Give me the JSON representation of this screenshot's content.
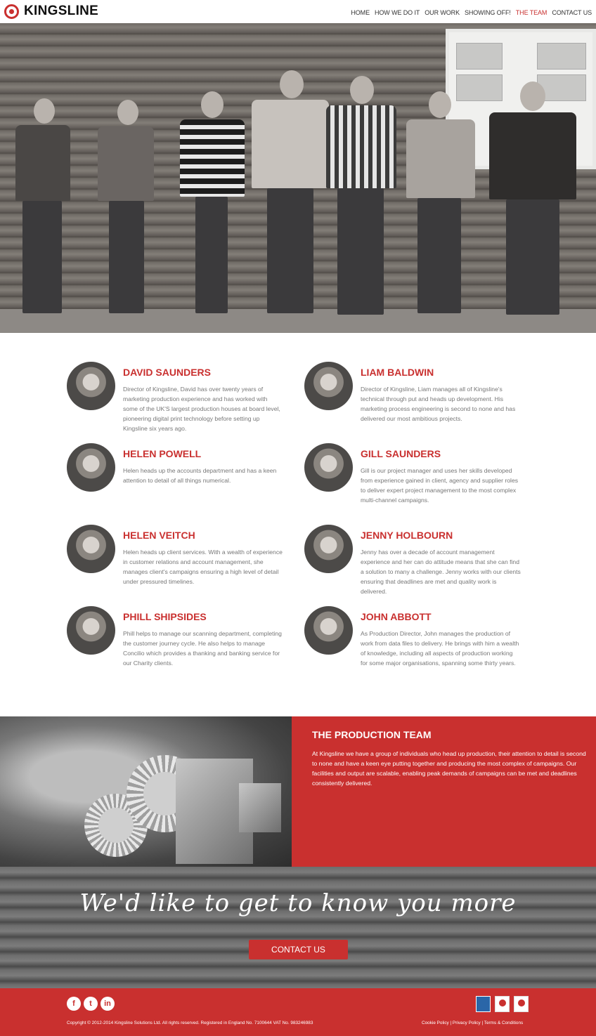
{
  "brand": {
    "name": "KINGSLINE",
    "accent": "#c9302f"
  },
  "nav": {
    "items": [
      {
        "label": "HOME"
      },
      {
        "label": "HOW WE DO IT"
      },
      {
        "label": "OUR WORK"
      },
      {
        "label": "SHOWING OFF!"
      },
      {
        "label": "THE TEAM"
      },
      {
        "label": "CONTACT US"
      }
    ],
    "active": "THE TEAM"
  },
  "team": [
    {
      "name": "DAVID SAUNDERS",
      "bio": "Director of Kingsline, David has over twenty years of marketing production experience and has worked with some of the UK'S largest production houses at board level, pioneering digital print technology before setting up Kingsline six years ago."
    },
    {
      "name": "LIAM BALDWIN",
      "bio": "Director of Kingsline, Liam manages all of Kingsline's technical through put and heads up development. His marketing process engineering is second to none and has delivered our most ambitious projects."
    },
    {
      "name": "HELEN POWELL",
      "bio": "Helen heads up the accounts department and has a keen attention to detail of all things numerical."
    },
    {
      "name": "GILL SAUNDERS",
      "bio": "Gill is our project manager and uses her skills developed from experience gained in client, agency and supplier roles to deliver expert project management to the most complex multi-channel campaigns."
    },
    {
      "name": "HELEN VEITCH",
      "bio": "Helen heads up client services. With a wealth of experience in customer relations and account management, she manages client's campaigns ensuring a high level of detail under pressured timelines."
    },
    {
      "name": "JENNY HOLBOURN",
      "bio": "Jenny has over a decade of account management experience and her can do attitude means that she can find a solution to many a challenge. Jenny works with our clients ensuring that deadlines are met and quality work is delivered."
    },
    {
      "name": "PHILL SHIPSIDES",
      "bio": "Phill helps to manage our scanning department, completing the customer journey cycle. He also helps to manage Concilio which provides a thanking and banking service for our Charity clients."
    },
    {
      "name": "JOHN ABBOTT",
      "bio": "As Production Director, John manages the production of work from data files to delivery. He brings with him a wealth of knowledge, including all aspects of production working for some major organisations, spanning some thirty years."
    }
  ],
  "production": {
    "title": "THE PRODUCTION TEAM",
    "text": "At Kingsline we have a group of individuals who head up production, their attention to detail is second to none and have a keen eye putting together and producing the most complex of campaigns. Our facilities and output are scalable, enabling peak demands of campaigns can be met and deadlines consistently delivered."
  },
  "cta": {
    "heading": "We'd like to get to know you more",
    "button": "CONTACT US"
  },
  "footer": {
    "social": [
      {
        "icon": "facebook-icon",
        "glyph": "f"
      },
      {
        "icon": "twitter-icon",
        "glyph": "t"
      },
      {
        "icon": "linkedin-icon",
        "glyph": "in"
      }
    ],
    "badges": [
      {
        "icon": "dma-badge-icon"
      },
      {
        "icon": "award-winner-badge-icon"
      },
      {
        "icon": "award-winner-badge-icon"
      }
    ],
    "copyright": "Copyright © 2012-2014 Kingsline Solutions Ltd. All rights reserved. Registered in England No. 7100644 VAT No. 983246983",
    "links": "Cookie Policy | Privacy Policy | Terms & Conditions"
  }
}
